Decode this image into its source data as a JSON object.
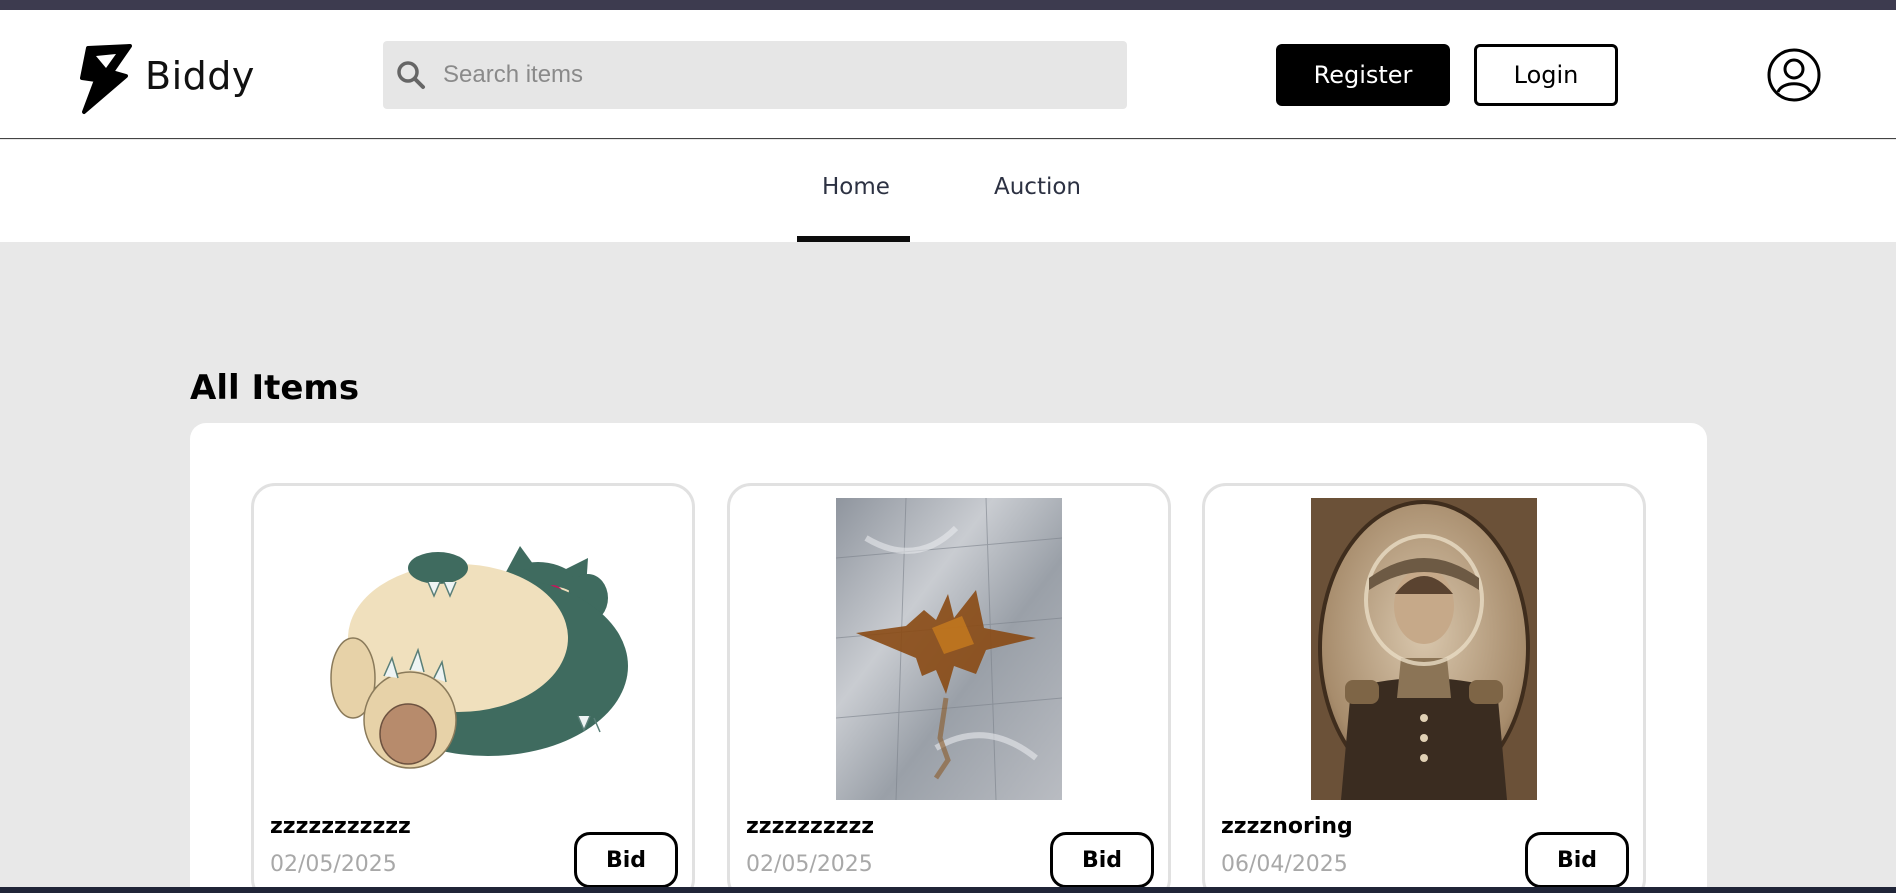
{
  "header": {
    "brand": "Biddy",
    "search_placeholder": "Search items",
    "register_label": "Register",
    "login_label": "Login"
  },
  "nav": {
    "tabs": [
      {
        "label": "Home",
        "active": true
      },
      {
        "label": "Auction",
        "active": false
      }
    ]
  },
  "main": {
    "title": "All Items",
    "items": [
      {
        "name": "zzzzzzzzzzz",
        "date": "02/05/2025",
        "bid_label": "Bid",
        "image": "sleeping-green-cream-creature"
      },
      {
        "name": "zzzzzzzzzz",
        "date": "02/05/2025",
        "bid_label": "Bid",
        "image": "brown-splatter-on-marble-floor"
      },
      {
        "name": "zzzznoring",
        "date": "06/04/2025",
        "bid_label": "Bid",
        "image": "sepia-portrait-man-in-space-helmet"
      }
    ]
  },
  "colors": {
    "top_strip": "#3d3b4f",
    "page_bg": "#e8e8e8",
    "accent": "#000000",
    "muted_text": "#a8a8a8"
  }
}
